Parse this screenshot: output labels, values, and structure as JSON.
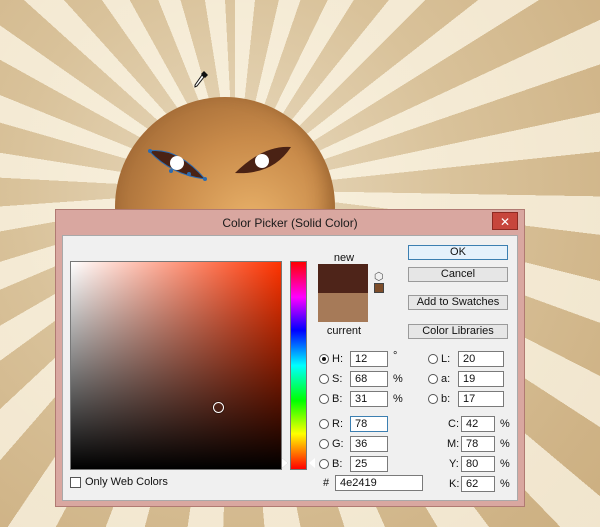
{
  "dialog": {
    "title": "Color Picker (Solid Color)",
    "close_glyph": "✕",
    "new_label": "new",
    "current_label": "current",
    "new_color": "#4e2419",
    "current_color": "#a67a58",
    "buttons": {
      "ok": "OK",
      "cancel": "Cancel",
      "add_to_swatches": "Add to Swatches",
      "color_libraries": "Color Libraries"
    },
    "hsb": {
      "h": {
        "label": "H:",
        "value": "12",
        "unit": "°"
      },
      "s": {
        "label": "S:",
        "value": "68",
        "unit": "%"
      },
      "b": {
        "label": "B:",
        "value": "31",
        "unit": "%"
      }
    },
    "rgb": {
      "r": {
        "label": "R:",
        "value": "78"
      },
      "g": {
        "label": "G:",
        "value": "36"
      },
      "b": {
        "label": "B:",
        "value": "25"
      }
    },
    "lab": {
      "l": {
        "label": "L:",
        "value": "20"
      },
      "a": {
        "label": "a:",
        "value": "19"
      },
      "b": {
        "label": "b:",
        "value": "17"
      }
    },
    "cmyk": {
      "c": {
        "label": "C:",
        "value": "42",
        "unit": "%"
      },
      "m": {
        "label": "M:",
        "value": "78",
        "unit": "%"
      },
      "y": {
        "label": "Y:",
        "value": "80",
        "unit": "%"
      },
      "k": {
        "label": "K:",
        "value": "62",
        "unit": "%"
      }
    },
    "only_web_colors_label": "Only Web Colors",
    "only_web_colors_checked": false,
    "hex_label": "#",
    "hex_value": "4e2419"
  },
  "canvas": {
    "icons": [
      "eyedropper-icon",
      "cube-icon"
    ]
  }
}
